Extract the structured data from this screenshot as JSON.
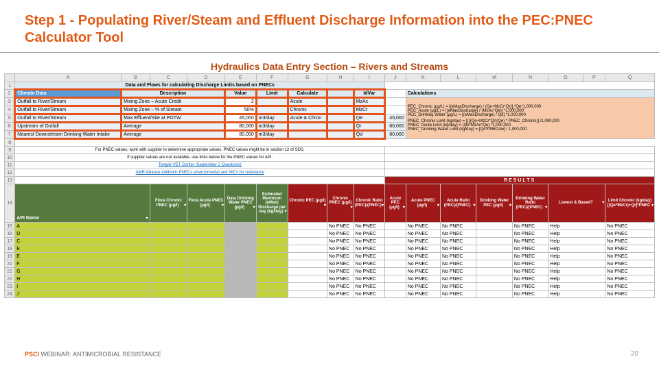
{
  "title": "Step 1 - Populating River/Steam and Effluent Discharge Information into the PEC:PNEC Calculator Tool",
  "subtitle": "Hydraulics Data Entry Section – Rivers and Streams",
  "cols": [
    "",
    "A",
    "B",
    "C",
    "D",
    "E",
    "F",
    "G",
    "H",
    "I",
    "J",
    "K",
    "L",
    "M",
    "N",
    "O",
    "P",
    "Q"
  ],
  "section_header": "Data and Flows for calculating Discharge Limits based on PNECs",
  "th": {
    "climate": "Climate Data",
    "desc": "Description",
    "value": "Value",
    "limit": "Limit",
    "calc": "Calculate",
    "idvar": "IdVar",
    "calculations": "Calculations"
  },
  "rows": [
    {
      "n": "3",
      "a": "Outfall to River/Stream",
      "c": "Mixing Zone – Acute Credit",
      "e": "2",
      "g": "Acute",
      "i": "MzAc"
    },
    {
      "n": "4",
      "a": "Outfall to River/Stream",
      "c": "Mixing Zone – % of Stream",
      "e": "50%",
      "g": "Chronic",
      "i": "MzCr"
    },
    {
      "n": "5",
      "a": "Outfall to River/Stream",
      "c": "Max Effluent/Site at POTW",
      "e": "45,000",
      "f": "m3/day",
      "g": "Acute & Chron",
      "i": "Qe",
      "k": "45,000"
    },
    {
      "n": "6",
      "a": "Upstream of Outfall",
      "c": "Average",
      "e": "80,000",
      "f": "m3/day",
      "i": "Qr",
      "k": "80,000"
    },
    {
      "n": "7",
      "a": "Nearest Downstream Drinking Water Intake",
      "c": "Average",
      "e": "80,000",
      "f": "m3/day",
      "i": "Qd",
      "k": "80,000"
    }
  ],
  "calc": [
    "PEC_Chronic (μg/L) = [(eMaxDischarge) / (Qe+MzCr*Qr)] *Qe*1,000,000",
    "PEC_Acute (μg/L) = [(eMaxDischarge) / (MzAc*Qe)] *1,000,000",
    "PEC_Drinking Water (μg/L) = [(eMaxDischarge) / Qd] *1,000,000",
    "PNEC_Chronic Limit (kg/day) = [(((Qe+MzCr*Qr)/Qe) * PNEC_Chronic)] /1,000,000",
    "PNEC_Acute Limit (kg/day) = (Qe*MzAc*Qe) *1,000,000",
    "PNEC_Drinking Water Limit (kg/day) = [Qd*PNECdw] / 1,000,000"
  ],
  "notes": {
    "a": "For PNEC values, work with supplier to determine appropriate values. PNEC values might be in section 12 of SDS.",
    "b": "If supplier values are not available, use links below for the PNEC values for API.",
    "l1": "Temple VET Center (September 2 Questions)",
    "l2": "AMR Alliance Antibiotic PNECs environmental and MICs for resistance"
  },
  "results": "RESULTS",
  "hdrs": [
    "API Name",
    "Flora Chronic PNEC (μg/l)",
    "Flora Acute PNEC (μg/l)",
    "Data Drinking Water PNEC (μg/l)",
    "Estimated Maximum (eMax) Discharge per day (kg/day)",
    "Chronic PEC (μg/l)",
    "Chronic PNEC (μg/l)",
    "Chronic Ratio (PEC)/(PNEC)",
    "Acute PEC (μg/l)",
    "Acute PNEC (μg/l)",
    "Acute Ratio (PEC)/(PNEC)",
    "Drinking Water PEC (μg/l)",
    "Drinking Water Ratio (PEC)/(PNEC)",
    "Lowest & Based?",
    "Limit Chronic (kg/day) [(Qe*MzCr)+Qr]*PNEC"
  ],
  "apis": [
    "A",
    "D",
    "C",
    "E",
    "E",
    "F",
    "G",
    "H",
    "I",
    "J"
  ],
  "rownums": [
    "15",
    "16",
    "17",
    "18",
    "19",
    "20",
    "21",
    "22",
    "23",
    "24"
  ],
  "npnec": "No PNEC",
  "help": "Help",
  "footer_pre": "PSCI",
  "footer_rest": " WEBINAR: ANTIMICROBIAL RESISTANCE",
  "page": "20"
}
